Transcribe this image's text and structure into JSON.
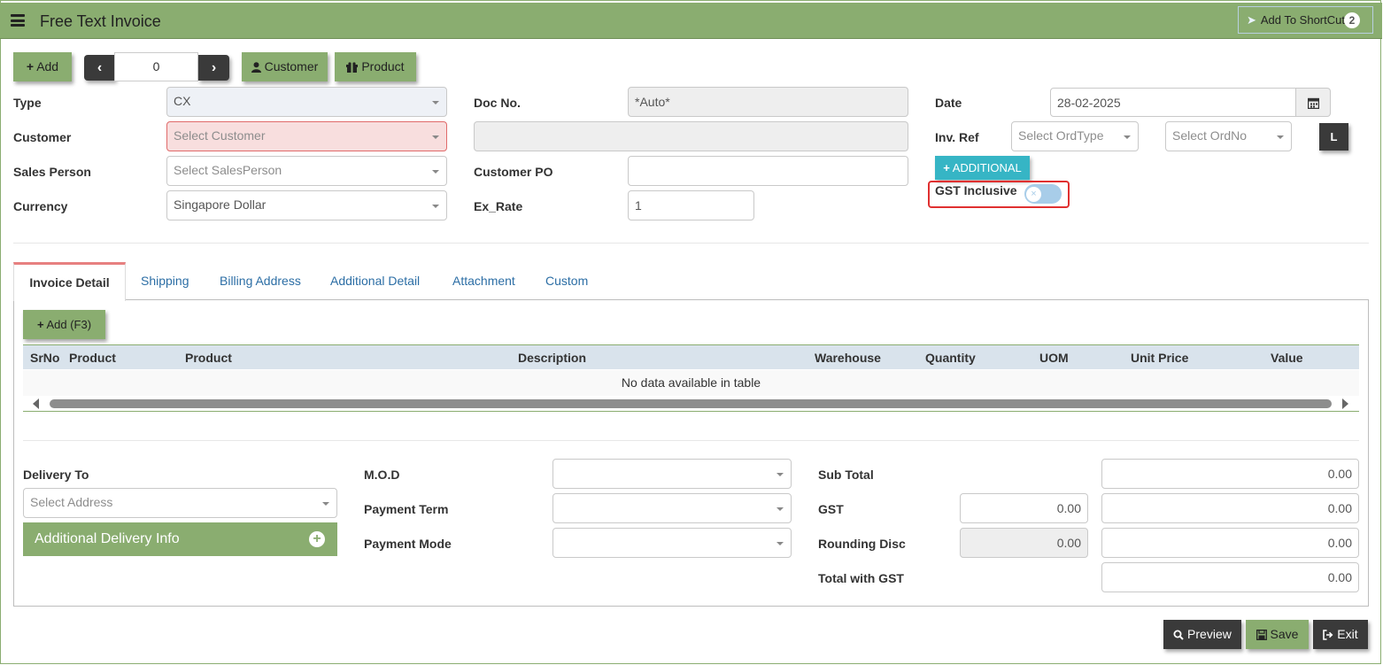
{
  "header": {
    "title": "Free Text Invoice",
    "shortcut_label": "Add To ShortCut",
    "shortcut_badge": "2"
  },
  "toolbar": {
    "add_label": "Add",
    "nav_value": "0",
    "customer_label": "Customer",
    "product_label": "Product"
  },
  "form": {
    "type_label": "Type",
    "type_value": "CX",
    "customer_label": "Customer",
    "customer_placeholder": "Select Customer",
    "sales_person_label": "Sales Person",
    "sales_person_placeholder": "Select SalesPerson",
    "currency_label": "Currency",
    "currency_value": "Singapore Dollar",
    "doc_no_label": "Doc No.",
    "doc_no_value": "*Auto*",
    "customer_name_value": "",
    "customer_po_label": "Customer PO",
    "customer_po_value": "",
    "ex_rate_label": "Ex_Rate",
    "ex_rate_value": "1",
    "date_label": "Date",
    "date_value": "28-02-2025",
    "inv_ref_label": "Inv. Ref",
    "ordtype_placeholder": "Select OrdType",
    "ordno_placeholder": "Select OrdNo",
    "l_button": "L",
    "additional_label": "ADDITIONAL",
    "gst_inclusive_label": "GST Inclusive",
    "gst_inclusive_on": false
  },
  "tabs": [
    "Invoice Detail",
    "Shipping",
    "Billing Address",
    "Additional Detail",
    "Attachment",
    "Custom"
  ],
  "detail": {
    "add_label": "Add (F3)",
    "columns": [
      "SrNo",
      "Product",
      "Product",
      "Description",
      "Warehouse",
      "Quantity",
      "UOM",
      "Unit Price",
      "Value"
    ],
    "empty_text": "No data available in table"
  },
  "footer": {
    "delivery_to_label": "Delivery To",
    "address_placeholder": "Select Address",
    "additional_delivery_label": "Additional Delivery Info",
    "mod_label": "M.O.D",
    "payment_term_label": "Payment Term",
    "payment_mode_label": "Payment Mode",
    "mod_value": "",
    "payment_term_value": "",
    "payment_mode_value": "",
    "sub_total_label": "Sub Total",
    "sub_total_value": "0.00",
    "gst_label": "GST",
    "gst_rate_value": "0.00",
    "gst_value": "0.00",
    "rounding_label": "Rounding Disc",
    "rounding_rate_value": "0.00",
    "rounding_value": "0.00",
    "total_label": "Total with GST",
    "total_value": "0.00"
  },
  "actions": {
    "preview_label": "Preview",
    "save_label": "Save",
    "exit_label": "Exit"
  },
  "colors": {
    "brand_green": "#8aad70",
    "accent_cyan": "#36b5c5",
    "dark_button": "#3a3a3a",
    "error_red": "#e03030"
  }
}
